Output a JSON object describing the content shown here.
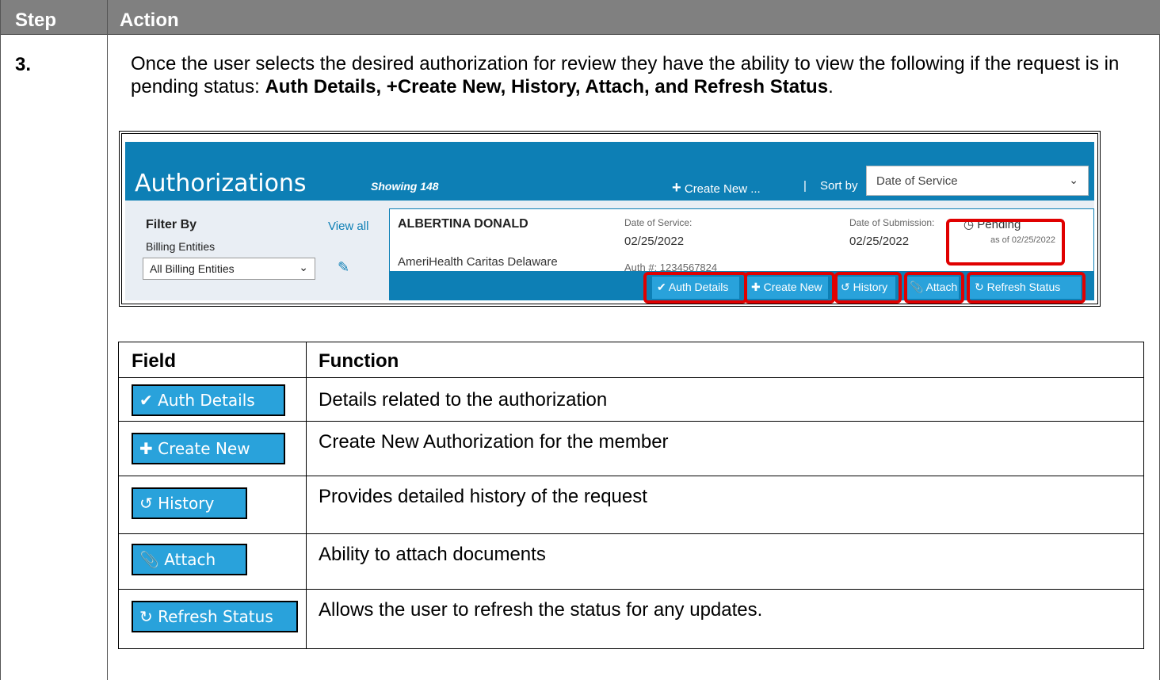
{
  "header": {
    "step": "Step",
    "action": "Action"
  },
  "step_number": "3.",
  "description": {
    "intro": "Once the user selects the desired authorization for review they have the ability to view the following if the request is in pending status: ",
    "bold": "Auth Details, +Create New, History, Attach, and Refresh Status",
    "end": "."
  },
  "screenshot": {
    "title": "Authorizations",
    "showing": "Showing 148",
    "create_new": "Create New ...",
    "separator": "|",
    "sort_by": "Sort by",
    "sort_value": "Date of Service",
    "filter": {
      "title": "Filter By",
      "view_all": "View all",
      "label": "Billing Entities",
      "select_value": "All Billing Entities"
    },
    "card": {
      "name": "ALBERTINA DONALD",
      "plan": "AmeriHealth Caritas Delaware",
      "dos_label": "Date of Service:",
      "dos_value": "02/25/2022",
      "auth_label": "Auth #: 1234567824",
      "dsub_label": "Date of Submission:",
      "dsub_value": "02/25/2022",
      "status": "Pending",
      "status_asof": "as of 02/25/2022"
    },
    "buttons": {
      "auth_details": "Auth Details",
      "create_new": "Create New",
      "history": "History",
      "attach": "Attach",
      "refresh": "Refresh Status"
    }
  },
  "field_table": {
    "headers": {
      "field": "Field",
      "function": "Function"
    },
    "rows": [
      {
        "button": "Auth Details",
        "function": "Details related to the authorization"
      },
      {
        "button": "Create New",
        "function": "Create New Authorization for the member"
      },
      {
        "button": "History",
        "function": "Provides detailed history of the request"
      },
      {
        "button": "Attach",
        "function": "Ability to attach documents"
      },
      {
        "button": "Refresh Status",
        "function": "Allows the user to refresh the status for any updates."
      }
    ]
  },
  "colors": {
    "header_bg": "#808080",
    "app_blue": "#0d7fb5",
    "button_blue": "#29a2db",
    "highlight": "#e00000"
  }
}
